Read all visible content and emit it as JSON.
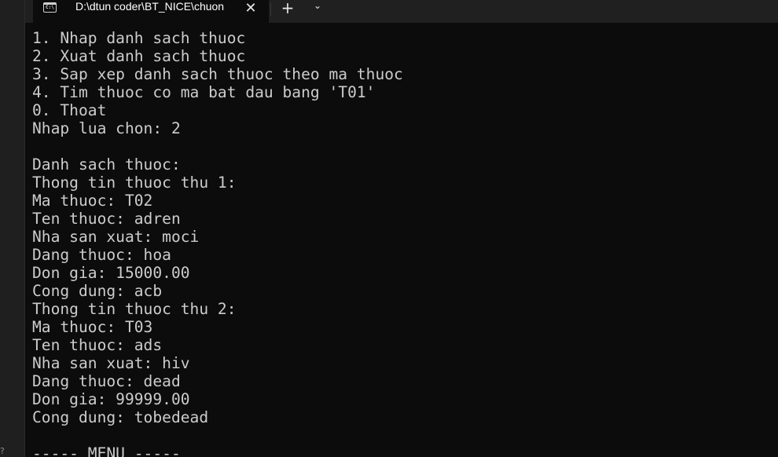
{
  "window": {
    "tab_title": "D:\\dtun coder\\BT_NICE\\chuon",
    "tab_icon_text": "C:\\",
    "close_glyph": "✕",
    "new_tab_glyph": "+",
    "dropdown_glyph": "⌄"
  },
  "terminal": {
    "lines": [
      "1. Nhap danh sach thuoc",
      "2. Xuat danh sach thuoc",
      "3. Sap xep danh sach thuoc theo ma thuoc",
      "4. Tim thuoc co ma bat dau bang 'T01'",
      "0. Thoat",
      "Nhap lua chon: 2",
      "",
      "Danh sach thuoc:",
      "Thong tin thuoc thu 1:",
      "Ma thuoc: T02",
      "Ten thuoc: adren",
      "Nha san xuat: moci",
      "Dang thuoc: hoa",
      "Don gia: 15000.00",
      "Cong dung: acb",
      "Thong tin thuoc thu 2:",
      "Ma thuoc: T03",
      "Ten thuoc: ads",
      "Nha san xuat: hiv",
      "Dang thuoc: dead",
      "Don gia: 99999.00",
      "Cong dung: tobedead",
      "",
      "----- MENU -----"
    ]
  },
  "colors": {
    "terminal_bg": "#0c0c0c",
    "terminal_fg": "#cccccc",
    "tabbar_bg": "#202020"
  }
}
